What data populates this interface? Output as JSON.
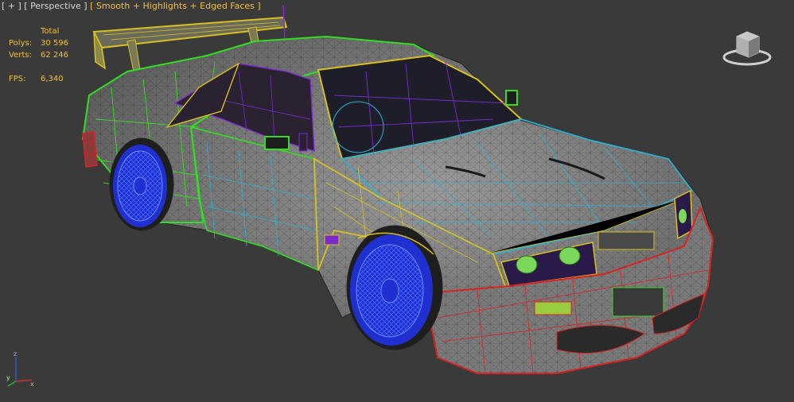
{
  "viewport": {
    "label_plus": "[ + ]",
    "label_view": "[ Perspective ]",
    "label_shading": "[ Smooth + Highlights + Edged Faces ]"
  },
  "stats": {
    "header": "Total",
    "polys_label": "Polys:",
    "polys_value": "30 596",
    "verts_label": "Verts:",
    "verts_value": "62 246",
    "fps_label": "FPS:",
    "fps_value": "6,340"
  },
  "axis": {
    "x": "x",
    "y": "y",
    "z": "z"
  },
  "colors": {
    "accent": "#f0c040",
    "background": "#3a3a3a",
    "wire_green": "#33dd22",
    "wire_yellow": "#d8c020",
    "wire_cyan": "#30b0d0",
    "wire_red": "#dd2222",
    "wire_purple": "#7a2ad0",
    "wire_blue": "#2030d0"
  },
  "icons": [
    "viewcube-icon",
    "axis-tripod-icon"
  ]
}
